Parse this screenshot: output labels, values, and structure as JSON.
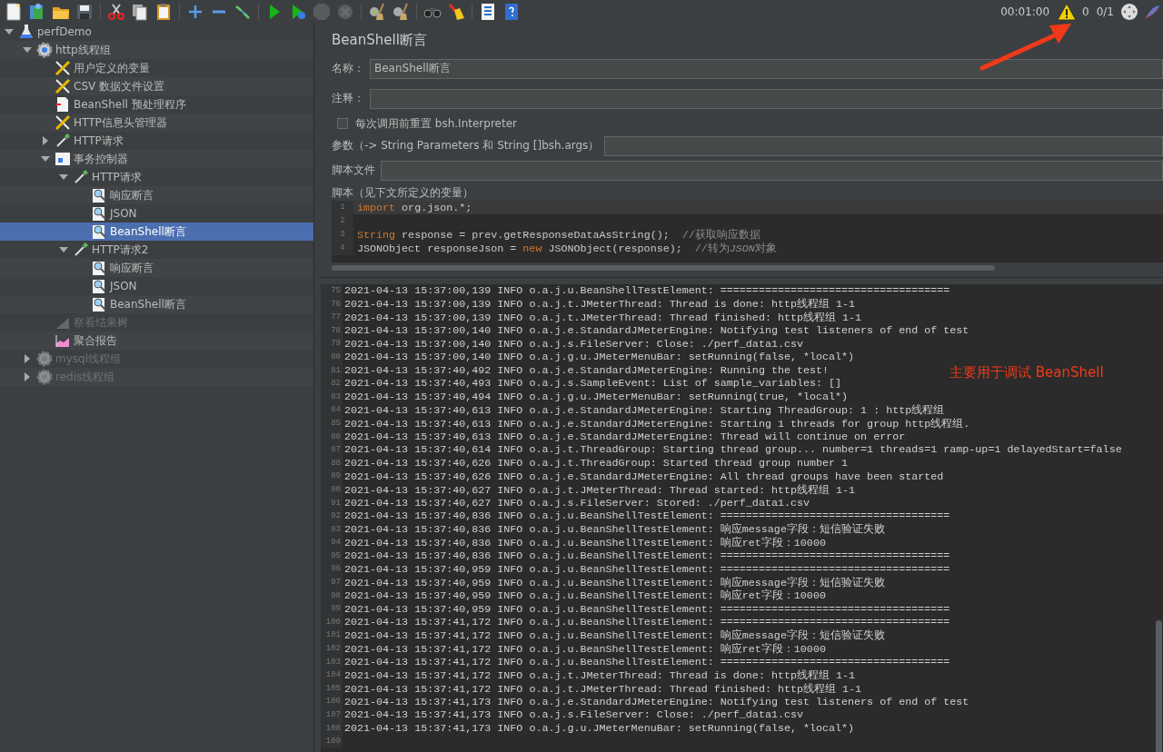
{
  "toolbar": {
    "buttons": [
      {
        "kind": "new",
        "disabled": false
      },
      {
        "kind": "templates",
        "disabled": false
      },
      {
        "kind": "open",
        "disabled": false
      },
      {
        "kind": "save",
        "disabled": false
      },
      {
        "kind": "separator"
      },
      {
        "kind": "cut",
        "disabled": false
      },
      {
        "kind": "copy",
        "disabled": false
      },
      {
        "kind": "paste",
        "disabled": false
      },
      {
        "kind": "separator"
      },
      {
        "kind": "expand",
        "disabled": false
      },
      {
        "kind": "collapse",
        "disabled": false
      },
      {
        "kind": "toggle",
        "disabled": false
      },
      {
        "kind": "separator"
      },
      {
        "kind": "start",
        "disabled": false
      },
      {
        "kind": "start-no-pause",
        "disabled": false
      },
      {
        "kind": "stop",
        "disabled": true
      },
      {
        "kind": "shutdown",
        "disabled": true
      },
      {
        "kind": "separator"
      },
      {
        "kind": "clear",
        "disabled": false
      },
      {
        "kind": "clear-all",
        "disabled": false
      },
      {
        "kind": "separator"
      },
      {
        "kind": "search",
        "disabled": false
      },
      {
        "kind": "reset-search",
        "disabled": false
      },
      {
        "kind": "separator"
      },
      {
        "kind": "function-helper",
        "disabled": false
      },
      {
        "kind": "help",
        "disabled": false
      }
    ],
    "elapsed": "00:01:00",
    "warnings": "0",
    "threads": "0/1"
  },
  "tree": {
    "items": [
      {
        "label": "perfDemo",
        "kind": "test-plan",
        "expanded": true,
        "selected": false,
        "disabled": false,
        "children": [
          {
            "label": "http线程组",
            "kind": "thread-group",
            "expanded": true,
            "selected": false,
            "disabled": false,
            "children": [
              {
                "label": "用户定义的变量",
                "kind": "config",
                "selected": false,
                "disabled": false
              },
              {
                "label": "CSV 数据文件设置",
                "kind": "config",
                "selected": false,
                "disabled": false
              },
              {
                "label": "BeanShell 预处理程序",
                "kind": "preprocessor",
                "selected": false,
                "disabled": false
              },
              {
                "label": "HTTP信息头管理器",
                "kind": "config",
                "selected": false,
                "disabled": false
              },
              {
                "label": "HTTP请求",
                "kind": "sampler",
                "expanded": false,
                "selected": false,
                "disabled": false
              },
              {
                "label": "事务控制器",
                "kind": "controller",
                "expanded": true,
                "selected": false,
                "disabled": false,
                "children": [
                  {
                    "label": "HTTP请求",
                    "kind": "sampler",
                    "expanded": true,
                    "selected": false,
                    "disabled": false,
                    "children": [
                      {
                        "label": "响应断言",
                        "kind": "assertion",
                        "selected": false,
                        "disabled": false
                      },
                      {
                        "label": "JSON",
                        "kind": "assertion",
                        "selected": false,
                        "disabled": false
                      },
                      {
                        "label": "BeanShell断言",
                        "kind": "assertion",
                        "selected": true,
                        "disabled": false
                      }
                    ]
                  },
                  {
                    "label": "HTTP请求2",
                    "kind": "sampler",
                    "expanded": true,
                    "selected": false,
                    "disabled": false,
                    "children": [
                      {
                        "label": "响应断言",
                        "kind": "assertion",
                        "selected": false,
                        "disabled": false
                      },
                      {
                        "label": "JSON",
                        "kind": "assertion",
                        "selected": false,
                        "disabled": false
                      },
                      {
                        "label": "BeanShell断言",
                        "kind": "assertion",
                        "selected": false,
                        "disabled": false
                      }
                    ]
                  }
                ]
              },
              {
                "label": "察看结果树",
                "kind": "listener",
                "selected": false,
                "disabled": true
              },
              {
                "label": "聚合报告",
                "kind": "report",
                "selected": false,
                "disabled": false
              }
            ]
          },
          {
            "label": "mysql线程组",
            "kind": "thread-group",
            "expanded": false,
            "selected": false,
            "disabled": true
          },
          {
            "label": "redis线程组",
            "kind": "thread-group",
            "expanded": false,
            "selected": false,
            "disabled": true
          }
        ]
      }
    ]
  },
  "panel": {
    "title": "BeanShell断言",
    "name": {
      "label": "名称：",
      "value": "BeanShell断言"
    },
    "comment": {
      "label": "注释："
    },
    "reset": {
      "label": "每次调用前重置 bsh.Interpreter",
      "checked": false
    },
    "parameters": {
      "label": "参数（-> String Parameters 和 String []bsh.args）"
    },
    "script_file": {
      "label": "脚本文件"
    },
    "script_label": "脚本（见下文所定义的变量）",
    "code": [
      {
        "n": "1",
        "current": true,
        "tokens": [
          {
            "kind": "keyword",
            "text": "import"
          },
          {
            "kind": "plain",
            "text": " org.json.*;"
          }
        ]
      },
      {
        "n": "2",
        "current": false
      },
      {
        "n": "3",
        "current": false,
        "tokens": [
          {
            "kind": "keyword",
            "text": "String"
          },
          {
            "kind": "plain",
            "text": " response = prev.getResponseDataAsString();  "
          },
          {
            "kind": "comment",
            "text": "//获取响应数据"
          }
        ]
      },
      {
        "n": "4",
        "current": false,
        "tokens": [
          {
            "kind": "plain",
            "text": "JSONObject responseJson = "
          },
          {
            "kind": "keyword",
            "text": "new"
          },
          {
            "kind": "plain",
            "text": " JSONObject(response);  "
          },
          {
            "kind": "comment",
            "text": "//转为"
          },
          {
            "kind": "comment",
            "italic": true,
            "text": "JSON"
          },
          {
            "kind": "comment",
            "text": "对象"
          }
        ]
      }
    ]
  },
  "log": [
    {
      "n": "75",
      "text": "2021-04-13 15:37:00,139 INFO o.a.j.u.BeanShellTestElement: ===================================="
    },
    {
      "n": "76",
      "text": "2021-04-13 15:37:00,139 INFO o.a.j.t.JMeterThread: Thread is done: http线程组 1-1"
    },
    {
      "n": "77",
      "text": "2021-04-13 15:37:00,139 INFO o.a.j.t.JMeterThread: Thread finished: http线程组 1-1"
    },
    {
      "n": "78",
      "text": "2021-04-13 15:37:00,140 INFO o.a.j.e.StandardJMeterEngine: Notifying test listeners of end of test"
    },
    {
      "n": "79",
      "text": "2021-04-13 15:37:00,140 INFO o.a.j.s.FileServer: Close: ./perf_data1.csv"
    },
    {
      "n": "80",
      "text": "2021-04-13 15:37:00,140 INFO o.a.j.g.u.JMeterMenuBar: setRunning(false, *local*)"
    },
    {
      "n": "81",
      "text": "2021-04-13 15:37:40,492 INFO o.a.j.e.StandardJMeterEngine: Running the test!"
    },
    {
      "n": "82",
      "text": "2021-04-13 15:37:40,493 INFO o.a.j.s.SampleEvent: List of sample_variables: []"
    },
    {
      "n": "83",
      "text": "2021-04-13 15:37:40,494 INFO o.a.j.g.u.JMeterMenuBar: setRunning(true, *local*)"
    },
    {
      "n": "84",
      "text": "2021-04-13 15:37:40,613 INFO o.a.j.e.StandardJMeterEngine: Starting ThreadGroup: 1 : http线程组"
    },
    {
      "n": "85",
      "text": "2021-04-13 15:37:40,613 INFO o.a.j.e.StandardJMeterEngine: Starting 1 threads for group http线程组."
    },
    {
      "n": "86",
      "text": "2021-04-13 15:37:40,613 INFO o.a.j.e.StandardJMeterEngine: Thread will continue on error"
    },
    {
      "n": "87",
      "text": "2021-04-13 15:37:40,614 INFO o.a.j.t.ThreadGroup: Starting thread group... number=1 threads=1 ramp-up=1 delayedStart=false"
    },
    {
      "n": "88",
      "text": "2021-04-13 15:37:40,626 INFO o.a.j.t.ThreadGroup: Started thread group number 1"
    },
    {
      "n": "89",
      "text": "2021-04-13 15:37:40,626 INFO o.a.j.e.StandardJMeterEngine: All thread groups have been started"
    },
    {
      "n": "90",
      "text": "2021-04-13 15:37:40,627 INFO o.a.j.t.JMeterThread: Thread started: http线程组 1-1"
    },
    {
      "n": "91",
      "text": "2021-04-13 15:37:40,627 INFO o.a.j.s.FileServer: Stored: ./perf_data1.csv"
    },
    {
      "n": "92",
      "text": "2021-04-13 15:37:40,836 INFO o.a.j.u.BeanShellTestElement: ===================================="
    },
    {
      "n": "93",
      "text": "2021-04-13 15:37:40,836 INFO o.a.j.u.BeanShellTestElement: 响应message字段：短信验证失败"
    },
    {
      "n": "94",
      "text": "2021-04-13 15:37:40,836 INFO o.a.j.u.BeanShellTestElement: 响应ret字段：10000"
    },
    {
      "n": "95",
      "text": "2021-04-13 15:37:40,836 INFO o.a.j.u.BeanShellTestElement: ===================================="
    },
    {
      "n": "96",
      "text": "2021-04-13 15:37:40,959 INFO o.a.j.u.BeanShellTestElement: ===================================="
    },
    {
      "n": "97",
      "text": "2021-04-13 15:37:40,959 INFO o.a.j.u.BeanShellTestElement: 响应message字段：短信验证失败"
    },
    {
      "n": "98",
      "text": "2021-04-13 15:37:40,959 INFO o.a.j.u.BeanShellTestElement: 响应ret字段：10000"
    },
    {
      "n": "99",
      "text": "2021-04-13 15:37:40,959 INFO o.a.j.u.BeanShellTestElement: ===================================="
    },
    {
      "n": "100",
      "text": "2021-04-13 15:37:41,172 INFO o.a.j.u.BeanShellTestElement: ===================================="
    },
    {
      "n": "101",
      "text": "2021-04-13 15:37:41,172 INFO o.a.j.u.BeanShellTestElement: 响应message字段：短信验证失败"
    },
    {
      "n": "102",
      "text": "2021-04-13 15:37:41,172 INFO o.a.j.u.BeanShellTestElement: 响应ret字段：10000"
    },
    {
      "n": "103",
      "text": "2021-04-13 15:37:41,172 INFO o.a.j.u.BeanShellTestElement: ===================================="
    },
    {
      "n": "104",
      "text": "2021-04-13 15:37:41,172 INFO o.a.j.t.JMeterThread: Thread is done: http线程组 1-1"
    },
    {
      "n": "105",
      "text": "2021-04-13 15:37:41,172 INFO o.a.j.t.JMeterThread: Thread finished: http线程组 1-1"
    },
    {
      "n": "106",
      "text": "2021-04-13 15:37:41,173 INFO o.a.j.e.StandardJMeterEngine: Notifying test listeners of end of test"
    },
    {
      "n": "107",
      "text": "2021-04-13 15:37:41,173 INFO o.a.j.s.FileServer: Close: ./perf_data1.csv"
    },
    {
      "n": "108",
      "text": "2021-04-13 15:37:41,173 INFO o.a.j.g.u.JMeterMenuBar: setRunning(false, *local*)"
    },
    {
      "n": "109"
    }
  ],
  "annotation": {
    "text": "主要用于调试 BeanShell"
  }
}
